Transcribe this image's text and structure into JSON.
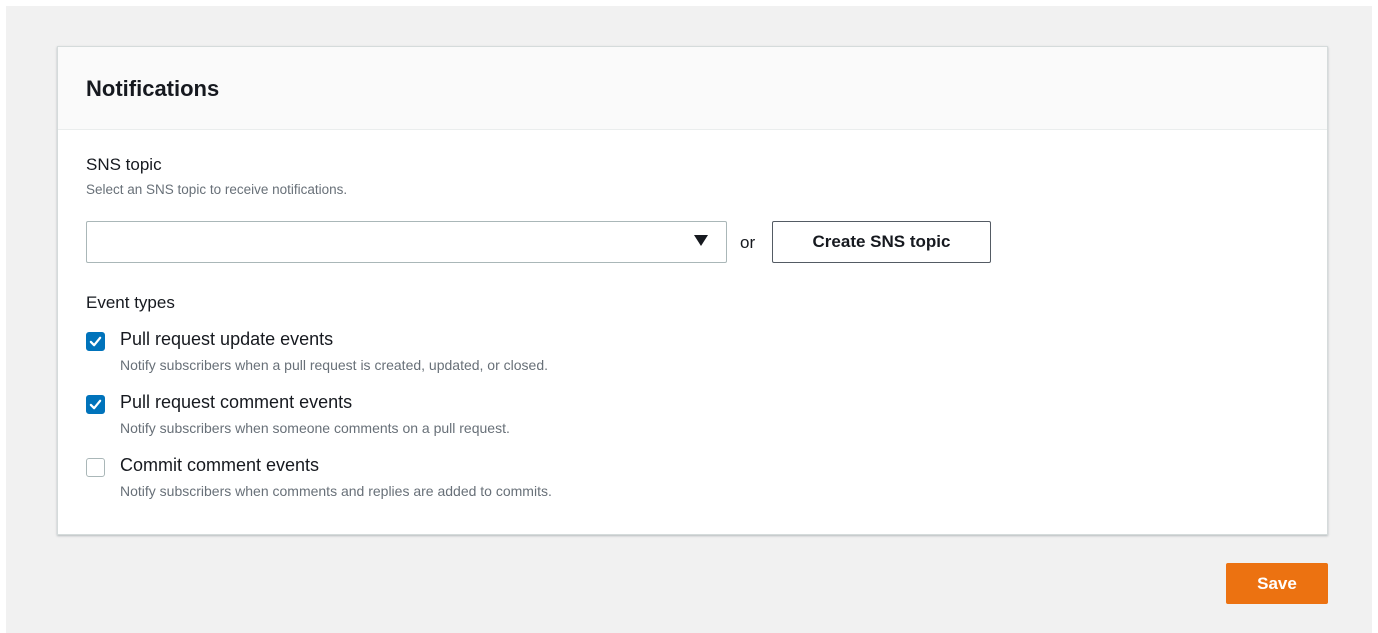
{
  "panel": {
    "title": "Notifications"
  },
  "sns": {
    "label": "SNS topic",
    "description": "Select an SNS topic to receive notifications.",
    "selected_value": "",
    "or_text": "or",
    "create_button_label": "Create SNS topic"
  },
  "event_types": {
    "label": "Event types",
    "options": [
      {
        "title": "Pull request update events",
        "description": "Notify subscribers when a pull request is created, updated, or closed.",
        "checked": true
      },
      {
        "title": "Pull request comment events",
        "description": "Notify subscribers when someone comments on a pull request.",
        "checked": true
      },
      {
        "title": "Commit comment events",
        "description": "Notify subscribers when comments and replies are added to commits.",
        "checked": false
      }
    ]
  },
  "footer": {
    "save_label": "Save"
  },
  "icons": {
    "select_caret": "caret-down-icon",
    "checkbox_mark": "checkmark-icon"
  },
  "colors": {
    "primary_button": "#ec7211",
    "checkbox_checked": "#0073bb",
    "page_background": "#f1f1f1",
    "description_text": "#687078"
  }
}
